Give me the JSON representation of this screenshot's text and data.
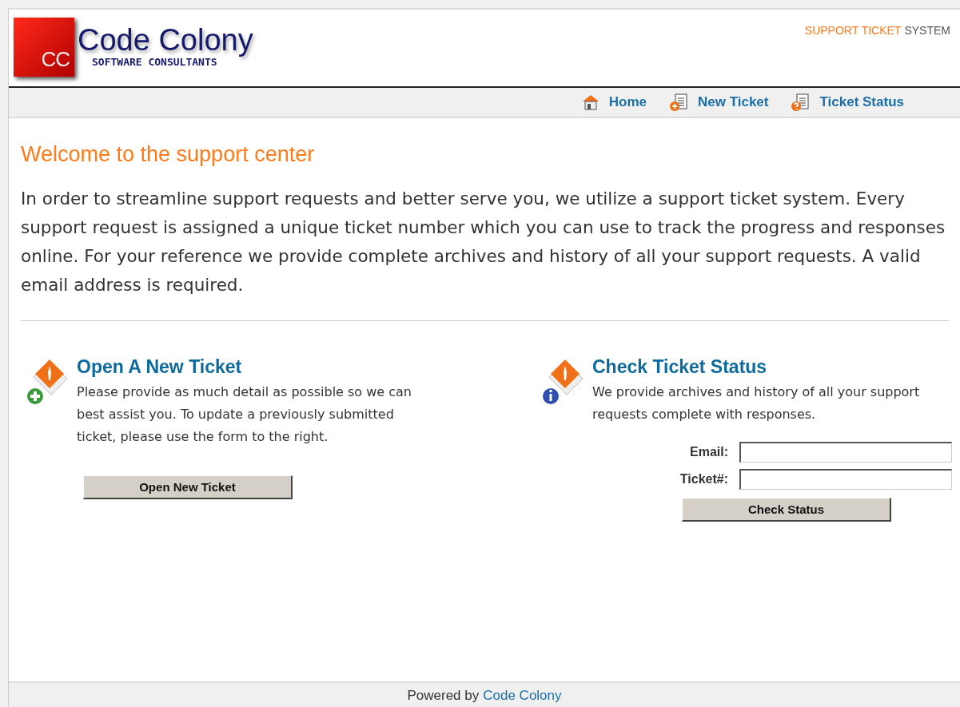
{
  "logo": {
    "mark": "CC",
    "name": "Code Colony",
    "subtitle": "SOFTWARE CONSULTANTS"
  },
  "tagline": {
    "highlight": "SUPPORT TICKET",
    "rest": "SYSTEM"
  },
  "nav": [
    {
      "label": "Home",
      "kind": "home"
    },
    {
      "label": "New Ticket",
      "kind": "new"
    },
    {
      "label": "Ticket Status",
      "kind": "status"
    }
  ],
  "welcome": {
    "title": "Welcome to the support center",
    "text": "In order to streamline support requests and better serve you, we utilize a support ticket system. Every support request is assigned a unique ticket number which you can use to track the progress and responses online. For your reference we provide complete archives and history of all your support requests. A valid email address is required."
  },
  "sections": [
    {
      "kind": "open",
      "title": "Open A New Ticket",
      "text": "Please provide as much detail as possible so we can best assist you. To update a previously submitted ticket, please use the form to the right.",
      "button": "Open New Ticket"
    },
    {
      "kind": "check",
      "title": "Check Ticket Status",
      "text": "We provide archives and history of all your support requests complete with responses.",
      "fields": [
        {
          "label": "Email:"
        },
        {
          "label": "Ticket#:"
        }
      ],
      "button": "Check Status"
    }
  ],
  "footer": {
    "text": "Powered by",
    "link": "Code Colony"
  }
}
